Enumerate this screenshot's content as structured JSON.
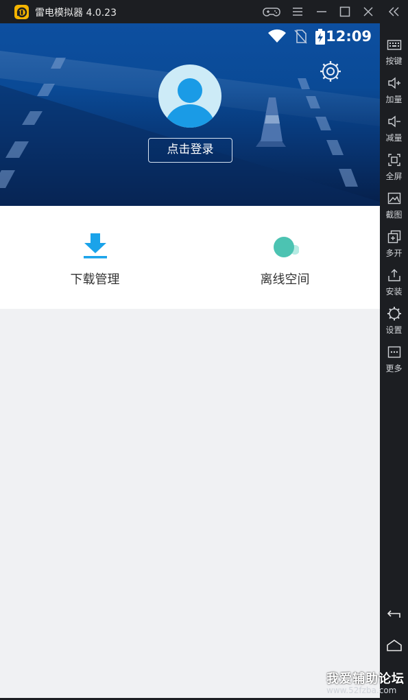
{
  "window": {
    "title": "雷电模拟器 4.0.23",
    "logo_icon": "ldplayer-logo-icon",
    "controls": [
      "gamepad-icon",
      "menu-icon",
      "minimize-icon",
      "maximize-icon",
      "close-icon",
      "collapse-sidebar-icon"
    ]
  },
  "statusbar": {
    "time": "12:09",
    "icons": [
      "wifi-icon",
      "no-sim-icon",
      "battery-charging-icon"
    ]
  },
  "profile": {
    "login_label": "点击登录",
    "settings_icon": "settings-icon",
    "avatar_icon": "default-avatar-icon"
  },
  "quick_actions": [
    {
      "label": "下载管理",
      "icon": "download-icon",
      "color": "#1aa3ea"
    },
    {
      "label": "离线空间",
      "icon": "cloud-icon",
      "color": "#4cc3b2"
    }
  ],
  "sidebar": {
    "items": [
      {
        "label": "按键",
        "icon": "keyboard-icon"
      },
      {
        "label": "加量",
        "icon": "volume-up-icon"
      },
      {
        "label": "减量",
        "icon": "volume-down-icon"
      },
      {
        "label": "全屏",
        "icon": "fullscreen-icon"
      },
      {
        "label": "截图",
        "icon": "screenshot-icon"
      },
      {
        "label": "多开",
        "icon": "multi-instance-icon"
      },
      {
        "label": "安装",
        "icon": "install-icon"
      },
      {
        "label": "设置",
        "icon": "settings-icon"
      },
      {
        "label": "更多",
        "icon": "more-icon"
      }
    ],
    "nav": [
      "back-icon",
      "home-icon"
    ]
  },
  "watermark": {
    "line1": "我爱辅助论坛",
    "line2": "www.52fzba.com"
  },
  "colors": {
    "header_top": "#0d4fa0",
    "header_bottom": "#061f4a",
    "frame": "#1c1e22",
    "content_bg": "#f0f1f3",
    "accent_blue": "#1aa3ea",
    "accent_teal": "#4cc3b2"
  }
}
